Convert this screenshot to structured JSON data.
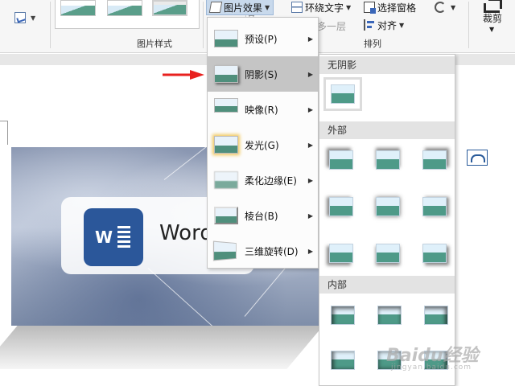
{
  "ribbon": {
    "picture_effects_label": "图片效果",
    "wrap_text_label": "环绕文字",
    "selection_pane_label": "选择窗格",
    "send_backward_label": "多一层",
    "align_label": "对齐",
    "crop_label": "裁剪",
    "picture_styles_group": "图片样式",
    "arrange_group": "排列"
  },
  "effects_menu": {
    "items": [
      {
        "label": "预设(P)",
        "icon": "preset-thumb-icon"
      },
      {
        "label": "阴影(S)",
        "icon": "shadow-thumb-icon"
      },
      {
        "label": "映像(R)",
        "icon": "reflection-thumb-icon"
      },
      {
        "label": "发光(G)",
        "icon": "glow-thumb-icon"
      },
      {
        "label": "柔化边缘(E)",
        "icon": "soft-edges-thumb-icon"
      },
      {
        "label": "棱台(B)",
        "icon": "bevel-thumb-icon"
      },
      {
        "label": "三维旋转(D)",
        "icon": "3d-rotation-thumb-icon"
      }
    ],
    "highlighted_index": 1
  },
  "shadow_submenu": {
    "no_shadow_header": "无阴影",
    "outer_header": "外部",
    "inner_header": "内部"
  },
  "document": {
    "picture_text": "Word"
  },
  "watermark": {
    "main": "Baidu经验",
    "sub": "jingyan.baidu.com"
  },
  "colors": {
    "accent_red": "#e8211f",
    "word_blue": "#2b579a",
    "menu_highlight": "#c5c5c5"
  }
}
